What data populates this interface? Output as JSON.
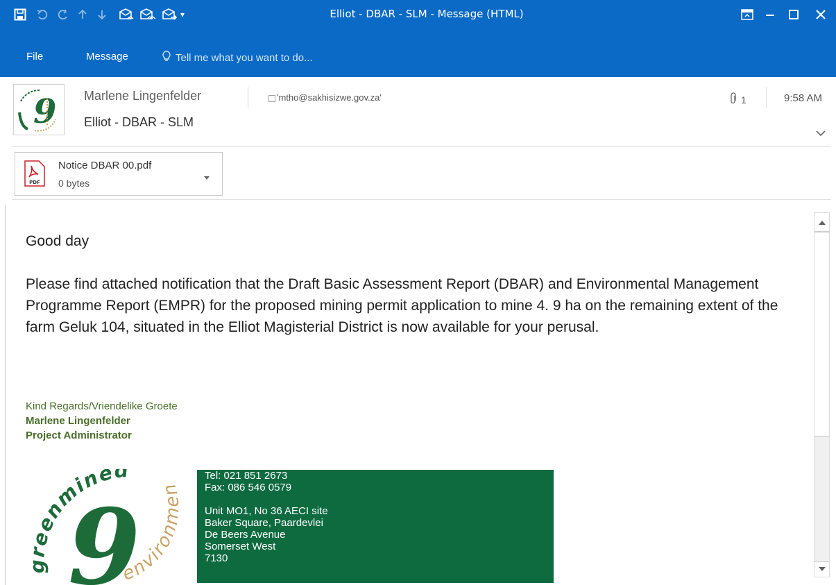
{
  "window": {
    "title": "Elliot - DBAR - SLM - Message (HTML)"
  },
  "ribbon": {
    "file": "File",
    "message": "Message",
    "tell_me": "Tell me what you want to do..."
  },
  "header": {
    "sender": "Marlene Lingenfelder",
    "to": "'mtho@sakhisizwe.gov.za'",
    "subject": "Elliot - DBAR - SLM",
    "attachment_count": "1",
    "time": "9:58 AM"
  },
  "attachment": {
    "name": "Notice DBAR 00.pdf",
    "size": "0 bytes",
    "type_label": "PDF"
  },
  "body": {
    "greeting": "Good day",
    "paragraph": "Please find attached notification that the Draft Basic Assessment Report (DBAR) and Environmental Management Programme Report (EMPR) for the proposed mining permit application to mine 4. 9 ha on the remaining extent of the farm Geluk 104, situated in the Elliot Magisterial District is now available for your perusal."
  },
  "signature": {
    "regards": "Kind Regards/Vriendelike Groete",
    "name": "Marlene Lingenfelder",
    "role": "Project Administrator"
  },
  "logo": {
    "word1": "greenmined",
    "word2": "environmental",
    "numeral": "9"
  },
  "contact": {
    "tel": "Tel: 021 851 2673",
    "fax": "Fax: 086 546 0579",
    "addr1": "Unit MO1, No 36 AECI site",
    "addr2": "Baker Square, Paardevlei",
    "addr3": "De Beers Avenue",
    "addr4": "Somerset West",
    "addr5": "7130"
  },
  "colors": {
    "titlebar": "#0a6ac5",
    "signature_green": "#4a6e2a",
    "contact_bg": "#0e6b3f",
    "logo_green": "#1e6b3a",
    "logo_tan": "#c9a263"
  }
}
